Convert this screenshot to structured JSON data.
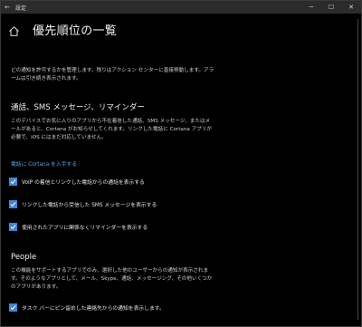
{
  "window": {
    "title": "設定",
    "controls": {
      "minimize": "─",
      "maximize": "☐",
      "close": "✕"
    },
    "back": "←"
  },
  "header": {
    "title": "優先順位の一覧"
  },
  "intro": "どの通知を許可するかを管理します。残りはアクション センターに直接移動します。アラームは引き続き表示されます。",
  "calls_section": {
    "title": "通話、SMS メッセージ、リマインダー",
    "description": "このデバイスでお気に入りのアプリから不在着信した通話、SMS メッセージ、またはメールがあると、Cortana がお知らせしてくれます。リンクした電話に Cortana アプリが必要で、iOS にはまだ対応していません。",
    "link": "電話に Cortana を入手する",
    "checkboxes": [
      {
        "label": "VoIP の着信とリンクした電話からの通話を表示する",
        "checked": true
      },
      {
        "label": "リンクした電話から受信した SMS メッセージを表示する",
        "checked": true
      },
      {
        "label": "使用されたアプリに関係なくリマインダーを表示する",
        "checked": true
      }
    ]
  },
  "people_section": {
    "title": "People",
    "description": "この機能をサポートするアプリでのみ、選択した他のユーザーからの通知が表示されます。そのようなアプリとして、メール、Skype、通話、メッセージング、その他いくつかのアプリがあります。",
    "checkboxes": [
      {
        "label": "タスク バーにピン留めした連絡先からの通知を表示します。",
        "checked": true
      }
    ]
  },
  "colors": {
    "accent": "#3f86d6",
    "link": "#58a6e8",
    "background": "#000000"
  }
}
